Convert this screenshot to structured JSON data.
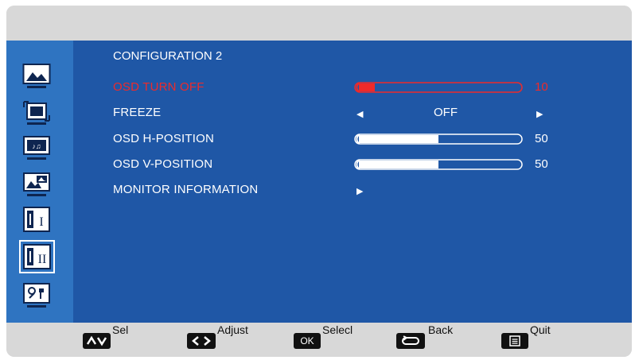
{
  "menu": {
    "title": "CONFIGURATION 2",
    "rows": [
      {
        "label": "OSD TURN OFF",
        "value": "10",
        "level_percent": 10
      },
      {
        "label": "FREEZE",
        "value": "OFF"
      },
      {
        "label": "OSD H-POSITION",
        "value": "50",
        "level_percent": 50
      },
      {
        "label": "OSD V-POSITION",
        "value": "50",
        "level_percent": 50
      },
      {
        "label": "MONITOR INFORMATION"
      }
    ]
  },
  "sidebar": {
    "icons": [
      "picture-icon",
      "screen-icon",
      "audio-icon",
      "pip-icon",
      "configuration-1-icon",
      "configuration-2-icon",
      "advanced-option-icon"
    ],
    "selected_index": 5
  },
  "footer": {
    "sel": "Sel",
    "adjust": "Adjust",
    "ok_key": "OK",
    "select": "Selecl",
    "back": "Back",
    "quit": "Quit"
  },
  "colors": {
    "main_bg": "#1f57a6",
    "sidebar_bg": "#2f74c1",
    "active_text": "#ee2a2a"
  }
}
